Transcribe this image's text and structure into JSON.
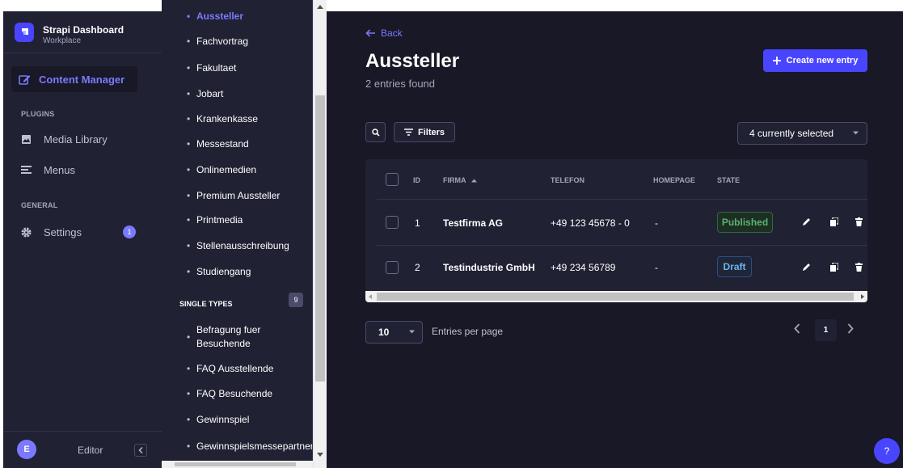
{
  "brand": {
    "title": "Strapi Dashboard",
    "subtitle": "Workplace"
  },
  "mainnav": {
    "content_manager": "Content Manager",
    "plugins_label": "PLUGINS",
    "media_library": "Media Library",
    "menus": "Menus",
    "general_label": "GENERAL",
    "settings": "Settings",
    "settings_badge": "1",
    "footer": {
      "avatar_initial": "E",
      "name": "Editor"
    }
  },
  "subnav": {
    "collection_items": [
      "Aussteller",
      "Fachvortrag",
      "Fakultaet",
      "Jobart",
      "Krankenkasse",
      "Messestand",
      "Onlinemedien",
      "Premium Aussteller",
      "Printmedia",
      "Stellenausschreibung",
      "Studiengang"
    ],
    "active_item": "Aussteller",
    "single_types_label": "SINGLE TYPES",
    "single_types_count": "9",
    "single_items": [
      "Befragung fuer Besuchende",
      "FAQ Ausstellende",
      "FAQ Besuchende",
      "Gewinnspiel",
      "Gewinnspielsmessepartner"
    ]
  },
  "header": {
    "back": "Back",
    "title": "Aussteller",
    "subtitle": "2 entries found",
    "create_button": "Create new entry"
  },
  "toolbar": {
    "filters": "Filters",
    "columns_selected": "4 currently selected"
  },
  "table": {
    "headers": {
      "id": "ID",
      "firma": "FIRMA",
      "telefon": "TELEFON",
      "homepage": "HOMEPAGE",
      "state": "STATE"
    },
    "rows": [
      {
        "id": "1",
        "firma": "Testfirma AG",
        "telefon": "+49 123 45678 - 0",
        "homepage": "-",
        "state": "Published"
      },
      {
        "id": "2",
        "firma": "Testindustrie GmbH",
        "telefon": "+49 234 56789",
        "homepage": "-",
        "state": "Draft"
      }
    ]
  },
  "pagination": {
    "per_page": "10",
    "per_page_label": "Entries per page",
    "current_page": "1"
  },
  "help": "?",
  "colors": {
    "accent": "#4945ff",
    "accent_light": "#7b79ff",
    "nav_bg": "#212134",
    "main_bg": "#181826",
    "published": "#5cb176",
    "draft": "#66b7f1"
  }
}
